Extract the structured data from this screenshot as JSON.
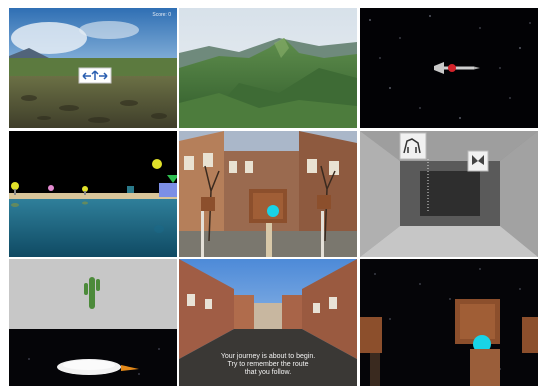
{
  "panels": [
    {
      "name": "maze-arrow-sign-scene",
      "hud": {
        "score_label": "Score: 0"
      }
    },
    {
      "name": "mountain-terrain-scene"
    },
    {
      "name": "space-dart-scene"
    },
    {
      "name": "floating-objects-water-scene"
    },
    {
      "name": "town-signpost-scene"
    },
    {
      "name": "corridor-icons-scene",
      "icons": [
        "dog-icon",
        "butterfly-icon"
      ]
    },
    {
      "name": "cactus-plate-scene"
    },
    {
      "name": "street-route-scene",
      "caption": {
        "line1": "Your journey is about to begin.",
        "line2": "Try to remember the route",
        "line3": "that you follow."
      }
    },
    {
      "name": "space-signpost-scene"
    }
  ],
  "colors": {
    "cyan_marker": "#19d3e6",
    "red_dart": "#d3222a",
    "green_cactus": "#4c8a3a"
  }
}
